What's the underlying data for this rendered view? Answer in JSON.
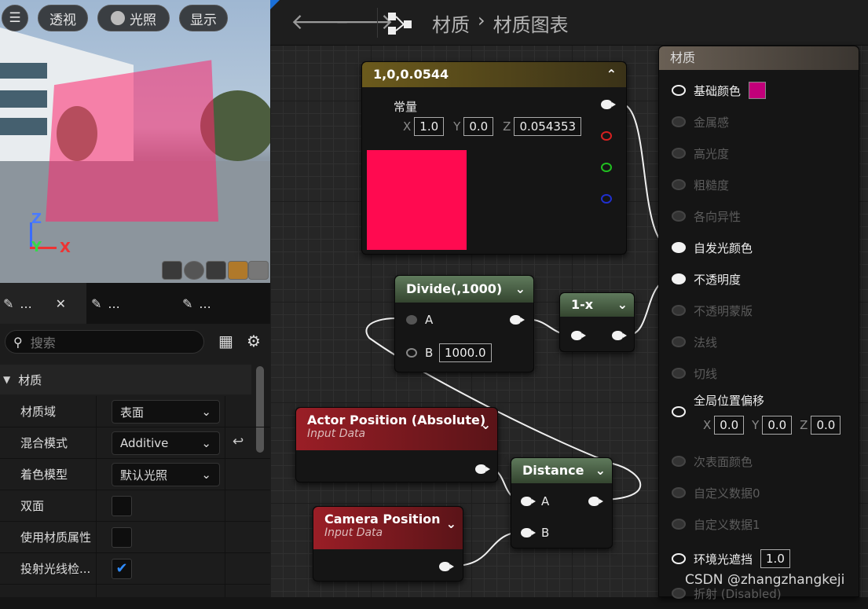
{
  "viewport": {
    "buttons": [
      "透视",
      "光照",
      "显示"
    ],
    "axes": {
      "z": "Z",
      "y": "Y",
      "x": "X"
    }
  },
  "details_panel": {
    "tabs": [
      "...",
      "...",
      "..."
    ],
    "search_placeholder": "搜索",
    "section": "材质",
    "rows": [
      {
        "label": "材质域",
        "value": "表面"
      },
      {
        "label": "混合模式",
        "value": "Additive"
      },
      {
        "label": "着色模型",
        "value": "默认光照"
      },
      {
        "label": "双面",
        "checked": false
      },
      {
        "label": "使用材质属性",
        "checked": false
      },
      {
        "label": "投射光线检...",
        "checked": true
      }
    ]
  },
  "graph_toolbar": {
    "breadcrumb_root": "材质",
    "breadcrumb_separator": "›",
    "breadcrumb_current": "材质图表"
  },
  "nodes": {
    "constant": {
      "title": "1,0,0.0544",
      "label": "常量",
      "x_label": "X",
      "x": "1.0",
      "y_label": "Y",
      "y": "0.0",
      "z_label": "Z",
      "z": "0.054353",
      "preview_color": "#ff0a50",
      "header_color": "#6b5a1c"
    },
    "divide": {
      "title": "Divide(,1000)",
      "pin_a": "A",
      "pin_b": "B",
      "b_value": "1000.0"
    },
    "one_minus": {
      "title": "1-x"
    },
    "actor_position": {
      "title": "Actor Position (Absolute)",
      "subtitle": "Input Data"
    },
    "camera_position": {
      "title": "Camera Position",
      "subtitle": "Input Data"
    },
    "distance": {
      "title": "Distance",
      "pin_a": "A",
      "pin_b": "B"
    },
    "material": {
      "title": "材质",
      "base_color_swatch": "#c2007a",
      "inputs": [
        {
          "label": "基础颜色",
          "connected": false,
          "active": true
        },
        {
          "label": "金属感",
          "active": false
        },
        {
          "label": "高光度",
          "active": false
        },
        {
          "label": "粗糙度",
          "active": false
        },
        {
          "label": "各向异性",
          "active": false
        },
        {
          "label": "自发光颜色",
          "active": true,
          "connected": true
        },
        {
          "label": "不透明度",
          "active": true,
          "connected": true
        },
        {
          "label": "不透明蒙版",
          "active": false
        },
        {
          "label": "法线",
          "active": false
        },
        {
          "label": "切线",
          "active": false
        },
        {
          "label": "全局位置偏移",
          "active": true
        },
        {
          "label": "次表面颜色",
          "active": false
        },
        {
          "label": "自定义数据0",
          "active": false
        },
        {
          "label": "自定义数据1",
          "active": false
        },
        {
          "label": "环境光遮挡",
          "active": true
        },
        {
          "label": "折射 (Disabled)",
          "active": false
        }
      ],
      "wpo": {
        "x_label": "X",
        "x": "0.0",
        "y_label": "Y",
        "y": "0.0",
        "z_label": "Z",
        "z": "0.0"
      },
      "ao_value": "1.0"
    }
  },
  "watermark": "CSDN @zhangzhangkeji"
}
